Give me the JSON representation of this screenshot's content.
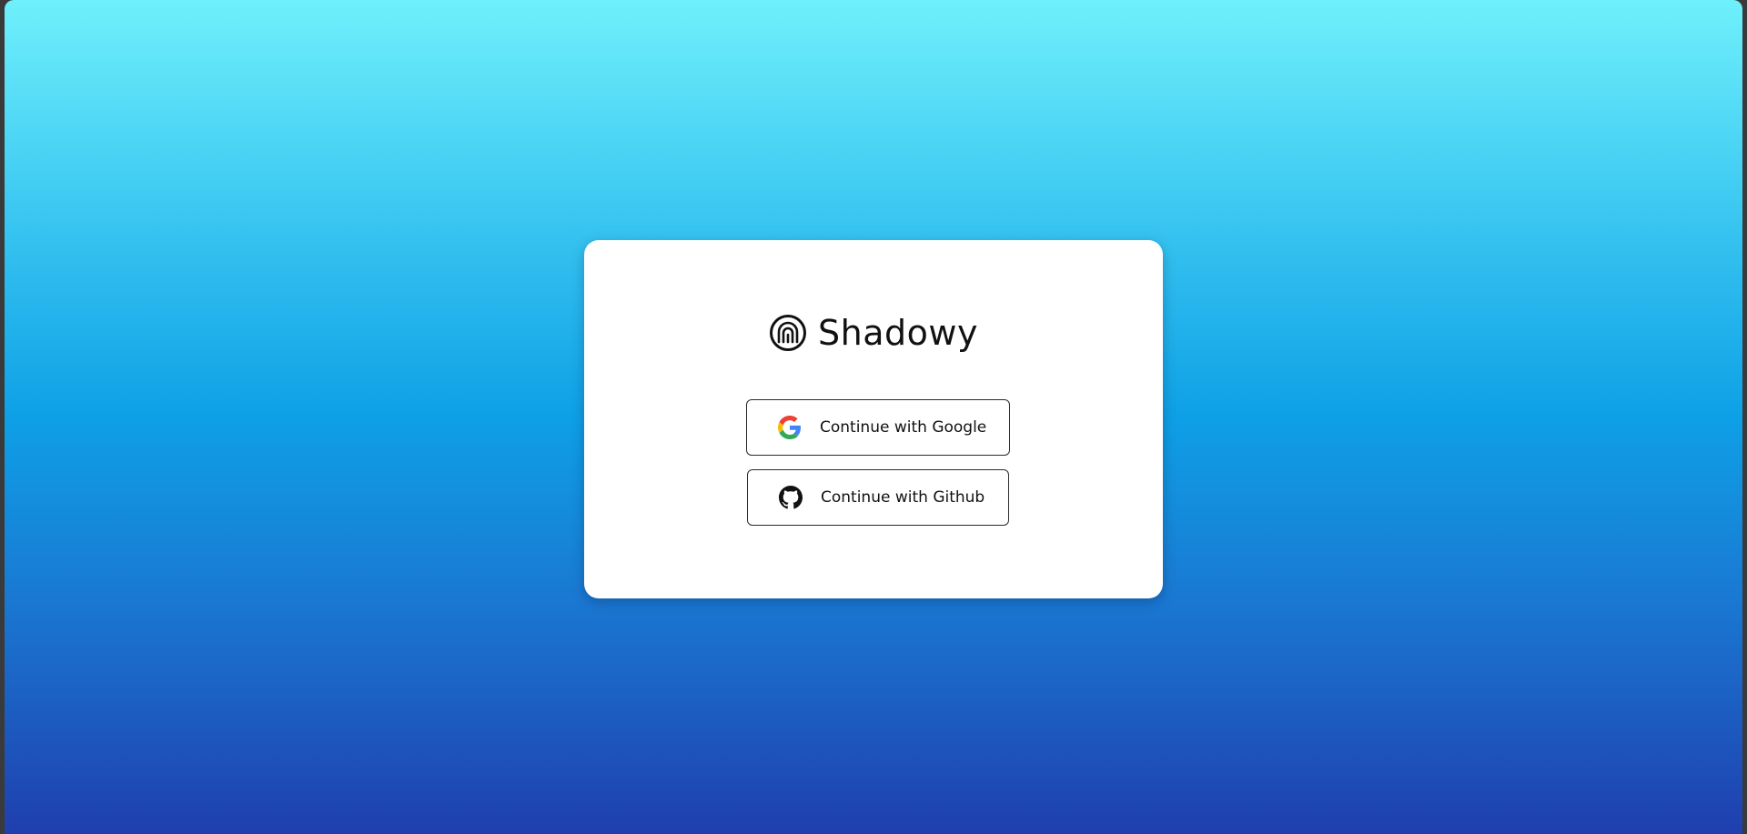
{
  "app": {
    "name": "Shadowy",
    "logo_icon": "fingerprint-icon"
  },
  "auth": {
    "google_label": "Continue with Google",
    "google_icon": "google-icon",
    "github_label": "Continue with Github",
    "github_icon": "github-icon"
  },
  "colors": {
    "background_top": "#6ff0fb",
    "background_mid": "#0ea0e6",
    "background_bottom": "#1f3fae",
    "card": "#ffffff",
    "text": "#111111"
  }
}
